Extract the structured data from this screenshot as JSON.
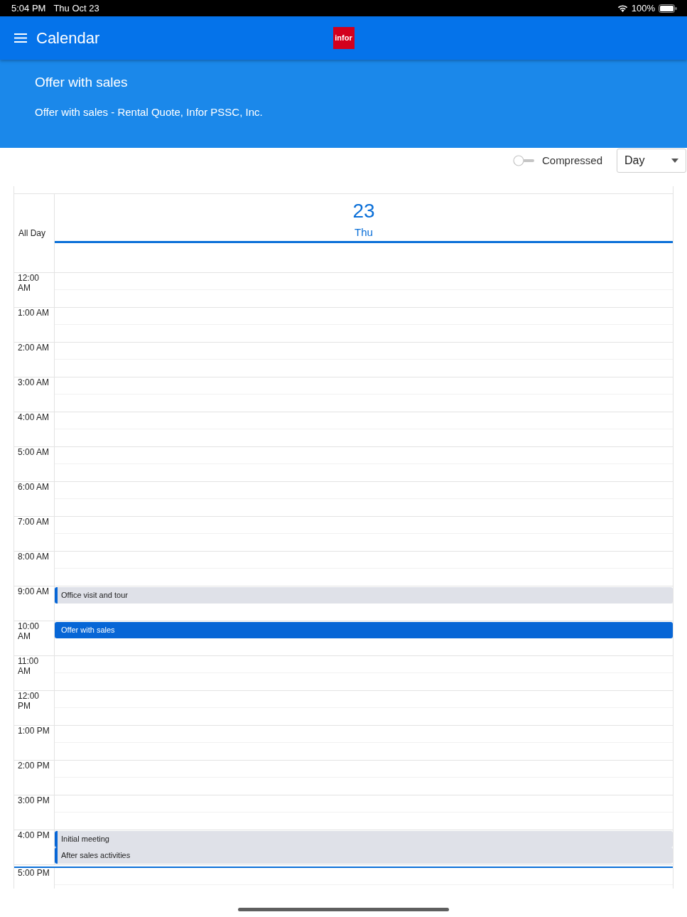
{
  "status_bar": {
    "time": "5:04 PM",
    "date": "Thu Oct 23",
    "battery": "100%"
  },
  "app_bar": {
    "title": "Calendar",
    "logo": "infor"
  },
  "event_header": {
    "title": "Offer with sales",
    "subtitle": "Offer with sales - Rental Quote, Infor PSSC, Inc."
  },
  "toolbar": {
    "compressed": {
      "label": "Compressed",
      "on": false
    },
    "view": {
      "value": "Day"
    }
  },
  "calendar": {
    "day": {
      "number": "23",
      "weekday": "Thu",
      "today": true
    },
    "all_day_label": "All Day",
    "hours": [
      {
        "label": "12:00 AM",
        "now": false
      },
      {
        "label": "1:00 AM",
        "now": false
      },
      {
        "label": "2:00 AM",
        "now": false
      },
      {
        "label": "3:00 AM",
        "now": false
      },
      {
        "label": "4:00 AM",
        "now": false
      },
      {
        "label": "5:00 AM",
        "now": false
      },
      {
        "label": "6:00 AM",
        "now": false
      },
      {
        "label": "7:00 AM",
        "now": false
      },
      {
        "label": "8:00 AM",
        "now": false
      },
      {
        "label": "9:00 AM",
        "now": false,
        "events": [
          {
            "title": "Office visit and tour",
            "selected": false
          }
        ]
      },
      {
        "label": "10:00 AM",
        "now": false,
        "events": [
          {
            "title": "Offer with sales",
            "selected": true
          }
        ]
      },
      {
        "label": "11:00 AM",
        "now": false
      },
      {
        "label": "12:00 PM",
        "now": false
      },
      {
        "label": "1:00 PM",
        "now": false
      },
      {
        "label": "2:00 PM",
        "now": false
      },
      {
        "label": "3:00 PM",
        "now": false
      },
      {
        "label": "4:00 PM",
        "now": false,
        "events": [
          {
            "title": "Initial meeting",
            "selected": false
          },
          {
            "title": "After sales activities",
            "selected": false
          }
        ]
      },
      {
        "label": "5:00 PM",
        "now": true
      }
    ]
  }
}
